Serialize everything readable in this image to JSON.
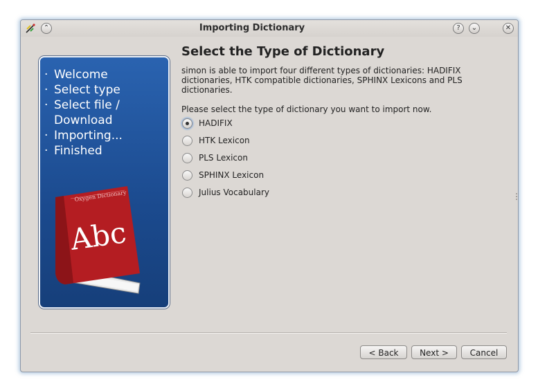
{
  "window": {
    "title": "Importing Dictionary",
    "help_glyph": "?",
    "min_glyph": "⌄",
    "close_glyph": "✕",
    "shade_glyph": "⌃"
  },
  "steps": [
    {
      "bullet": "·",
      "label": "Welcome"
    },
    {
      "bullet": "·",
      "label": "Select type"
    },
    {
      "bullet": "·",
      "label": "Select file /"
    },
    {
      "bullet": "",
      "label": "Download"
    },
    {
      "bullet": "·",
      "label": "Importing..."
    },
    {
      "bullet": "·",
      "label": "Finished"
    }
  ],
  "book": {
    "cover_title": "Oxygen Dictionary",
    "cover_text": "Abc",
    "color": "#b41d22"
  },
  "page": {
    "heading": "Select the Type of Dictionary",
    "description": "simon is able to import four different types of dictionaries: HADIFIX dictionaries, HTK compatible dictionaries, SPHINX Lexicons and PLS dictionaries.",
    "prompt": "Please select the type of dictionary you want to import now."
  },
  "options": [
    {
      "label": "HADIFIX",
      "checked": true
    },
    {
      "label": "HTK Lexicon",
      "checked": false
    },
    {
      "label": "PLS Lexicon",
      "checked": false
    },
    {
      "label": "SPHINX Lexicon",
      "checked": false
    },
    {
      "label": "Julius Vocabulary",
      "checked": false
    }
  ],
  "buttons": {
    "back": "< Back",
    "next": "Next >",
    "cancel": "Cancel"
  },
  "colors": {
    "panel_blue": "#1f5299",
    "focus_ring": "#7ea8dc"
  }
}
